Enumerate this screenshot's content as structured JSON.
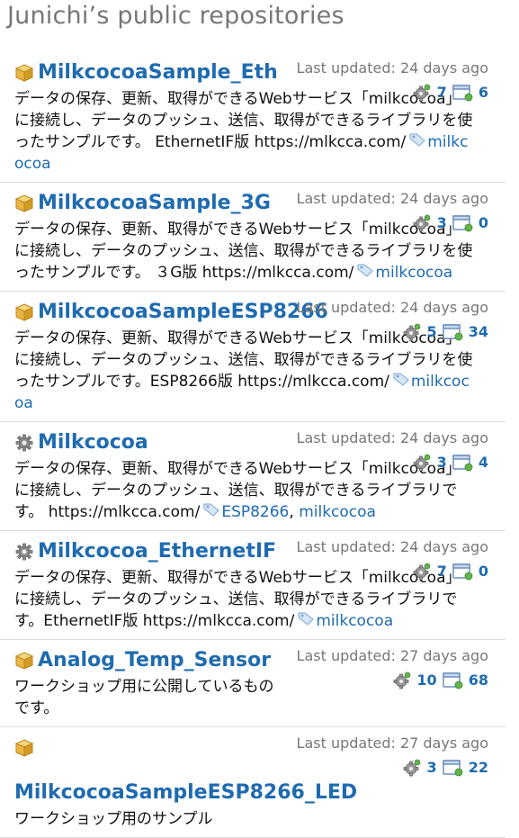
{
  "page_title": "Junichi’s public repositories",
  "colors": {
    "link": "#1f6bb0",
    "muted": "#777777"
  },
  "repos": [
    {
      "name": "MilkcocoaSample_Eth",
      "icon": "package-icon",
      "updated": "Last updated: 24 days ago",
      "forks": "7",
      "watchers": "6",
      "description": "データの保存、更新、取得ができるWebサービス「milkcocoa」に接続し、データのプッシュ、送信、取得ができるライブラリを使ったサンプルです。 EthernetIF版 https://mlkcca.com/",
      "tags": [
        "milkcocoa"
      ]
    },
    {
      "name": "MilkcocoaSample_3G",
      "icon": "package-icon",
      "updated": "Last updated: 24 days ago",
      "forks": "3",
      "watchers": "0",
      "description": "データの保存、更新、取得ができるWebサービス「milkcocoa」に接続し、データのプッシュ、送信、取得ができるライブラリを使ったサンプルです。 ３G版 https://mlkcca.com/",
      "tags": [
        "milkcocoa"
      ]
    },
    {
      "name": "MilkcocoaSampleESP8266",
      "icon": "package-icon",
      "updated": "Last updated: 24 days ago",
      "forks": "5",
      "watchers": "34",
      "description": "データの保存、更新、取得ができるWebサービス「milkcocoa」に接続し、データのプッシュ、送信、取得ができるライブラリを使ったサンプルです。ESP8266版 https://mlkcca.com/",
      "tags": [
        "milkcocoa"
      ]
    },
    {
      "name": "Milkcocoa",
      "icon": "gear-icon",
      "updated": "Last updated: 24 days ago",
      "forks": "3",
      "watchers": "4",
      "description": "データの保存、更新、取得ができるWebサービス「milkcocoa」に接続し、データのプッシュ、送信、取得ができるライブラリです。 https://mlkcca.com/",
      "tags": [
        "ESP8266",
        "milkcocoa"
      ]
    },
    {
      "name": "Milkcocoa_EthernetIF",
      "icon": "gear-icon",
      "updated": "Last updated: 24 days ago",
      "forks": "7",
      "watchers": "0",
      "description": "データの保存、更新、取得ができるWebサービス「milkcocoa」に接続し、データのプッシュ、送信、取得ができるライブラリです。EthernetIF版 https://mlkcca.com/",
      "tags": [
        "milkcocoa"
      ]
    },
    {
      "name": "Analog_Temp_Sensor",
      "icon": "package-icon",
      "updated": "Last updated: 27 days ago",
      "forks": "10",
      "watchers": "68",
      "description": "ワークショップ用に公開しているものです。",
      "tags": []
    },
    {
      "name": "MilkcocoaSampleESP8266_LED",
      "icon": "package-icon",
      "updated": "Last updated: 27 days ago",
      "forks": "3",
      "watchers": "22",
      "description": "ワークショップ用のサンプル",
      "tags": []
    }
  ]
}
